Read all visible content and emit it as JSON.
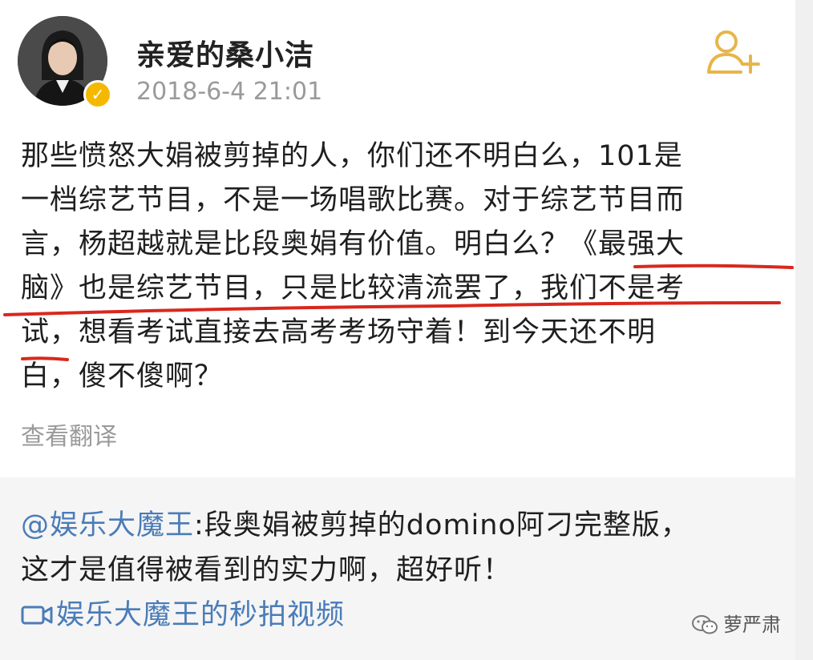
{
  "post": {
    "username": "亲爱的桑小洁",
    "timestamp": "2018-6-4 21:01",
    "verified_icon": "verified-v-badge",
    "follow_icon": "add-user-icon",
    "body_lines": [
      "那些愤怒大娟被剪掉的人，你们还不明白么，101是",
      "一档综艺节目，不是一场唱歌比赛。对于综艺节目而",
      "言，杨超越就是比段奥娟有价值。明白么？《最强大",
      "脑》也是综艺节目，只是比较清流罢了，我们不是考",
      "试，想看考试直接去高考考场守着！到今天还不明",
      "白，傻不傻啊？"
    ],
    "translate_label": "查看翻译"
  },
  "repost": {
    "mention": "@娱乐大魔王",
    "line1_rest": ":段奥娟被剪掉的domino阿刁完整版，",
    "line2": "这才是值得被看到的实力啊，超好听！",
    "video_label": "娱乐大魔王的秒拍视频",
    "video_icon": "video-camera-icon"
  },
  "watermark": {
    "label": "萝严肃",
    "icon": "wechat-icon"
  },
  "colors": {
    "accent_blue": "#4a7cb8",
    "underline_red": "#d8281e",
    "verified_gold": "#f5b800",
    "follow_gold": "#e7b54a"
  }
}
